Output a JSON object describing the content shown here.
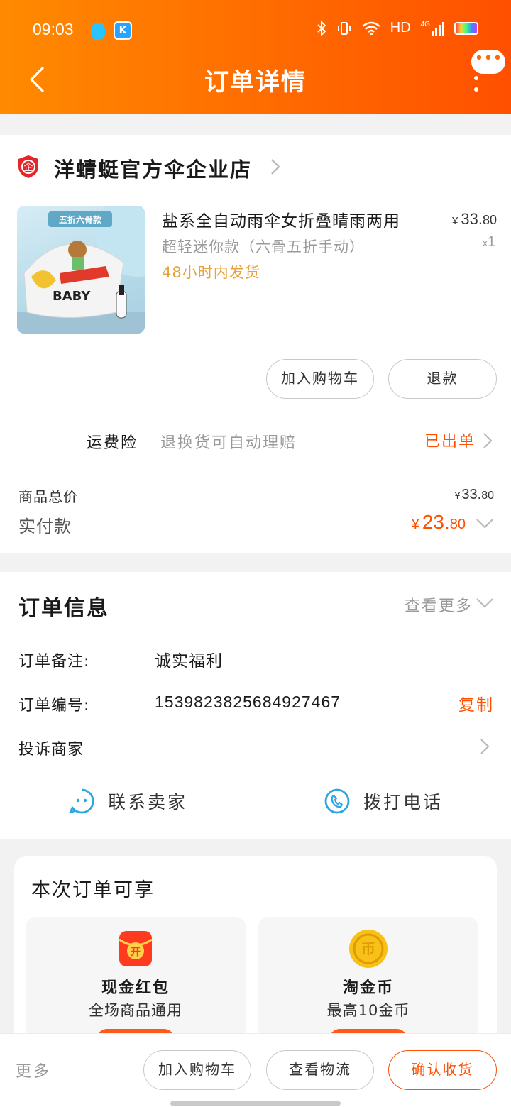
{
  "status_bar": {
    "time": "09:03",
    "network": "HD",
    "network_type": "4G"
  },
  "header": {
    "title": "订单详情"
  },
  "shop": {
    "name": "洋蜻蜓官方伞企业店",
    "badge": "企"
  },
  "product": {
    "title": "盐系全自动雨伞女折叠晴雨两用",
    "sku": "超轻迷你款（六骨五折手动）",
    "shipping": "48小时内发货",
    "price_symbol": "¥",
    "price_int": "33.",
    "price_dec": "80",
    "qty_prefix": "x",
    "qty": "1",
    "image_banner": "五折六骨款",
    "image_text": "BABY"
  },
  "item_actions": {
    "add_to_cart": "加入购物车",
    "refund": "退款"
  },
  "insurance": {
    "label": "运费险",
    "desc": "退换货可自动理赔",
    "status": "已出单"
  },
  "totals": {
    "goods_label": "商品总价",
    "goods_symbol": "¥",
    "goods_int": "33.",
    "goods_dec": "80",
    "paid_label": "实付款",
    "paid_symbol": "¥",
    "paid_int": "23.",
    "paid_dec": "80"
  },
  "order_info": {
    "title": "订单信息",
    "view_more": "查看更多",
    "remark_label": "订单备注:",
    "remark_value": "诚实福利",
    "number_label": "订单编号:",
    "number_value": "1539823825684927467",
    "copy_label": "复制",
    "complaint_label": "投诉商家"
  },
  "contact": {
    "seller": "联系卖家",
    "phone": "拨打电话"
  },
  "benefits": {
    "title": "本次订单可享",
    "items": [
      {
        "name": "现金红包",
        "desc": "全场商品通用",
        "icon_text": "开"
      },
      {
        "name": "淘金币",
        "desc": "最高10金币",
        "icon_text": "币"
      }
    ]
  },
  "bottom_bar": {
    "more": "更多",
    "add_to_cart": "加入购物车",
    "logistics": "查看物流",
    "confirm": "确认收货"
  },
  "colors": {
    "accent": "#ff5000",
    "header_start": "#ff8a00",
    "header_end": "#ff5000",
    "shipping": "#e8a33c",
    "contact_icon": "#2ca6e0"
  }
}
